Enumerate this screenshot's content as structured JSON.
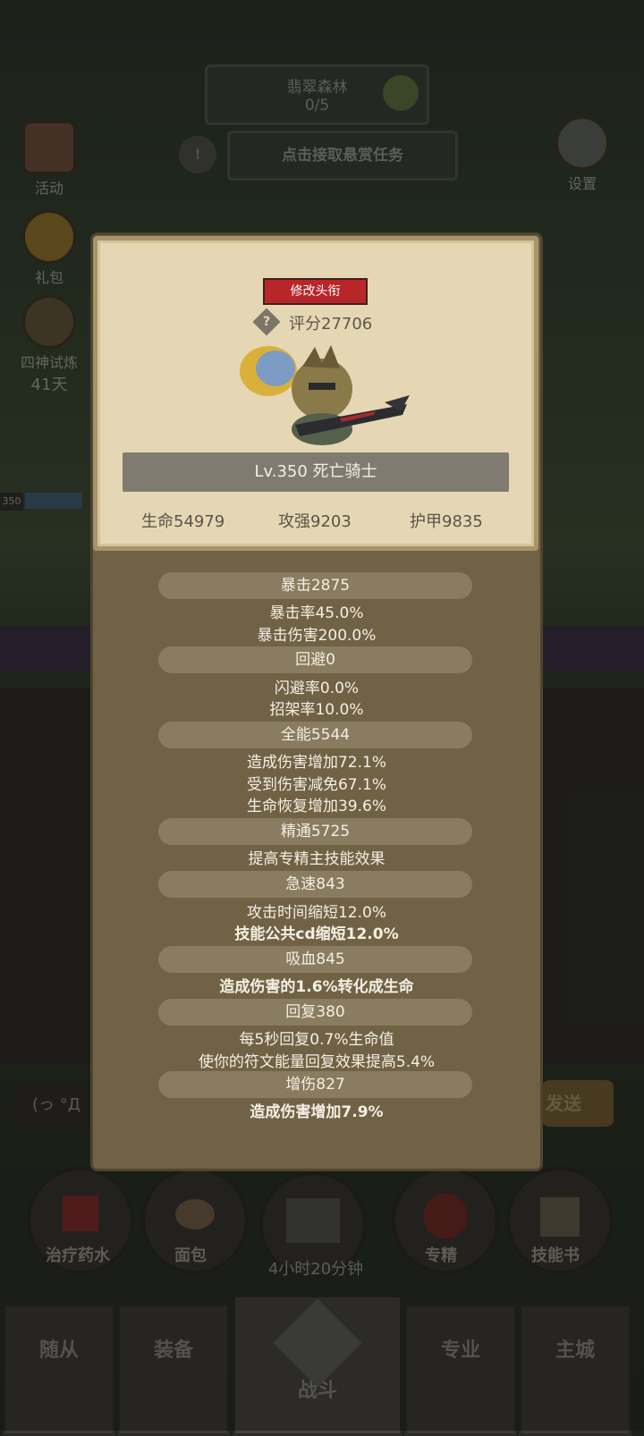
{
  "background": {
    "zone_name": "翡翠森林",
    "zone_progress": "0/5",
    "bounty_prompt": "点击接取悬赏任务",
    "left_menu": [
      {
        "label": "活动",
        "icon": "activity-scroll-icon"
      },
      {
        "label": "礼包",
        "icon": "gift-coin-icon"
      },
      {
        "label": "四神试炼",
        "icon": "trial-helmet-icon",
        "sub": "41天"
      }
    ],
    "settings_label": "设置",
    "player_level_badge": "350",
    "chat_prefix": "(っ °Д",
    "send_label": "发送",
    "quick_items": [
      {
        "label": "治疗药水",
        "icon": "potion-icon"
      },
      {
        "label": "面包",
        "icon": "bread-icon"
      },
      {
        "label": "4小时20分钟",
        "icon": "treasure-chest-icon"
      },
      {
        "label": "专精",
        "icon": "specialization-icon"
      },
      {
        "label": "技能书",
        "icon": "skill-book-icon"
      }
    ],
    "nav_tabs": [
      "随从",
      "装备",
      "战斗",
      "专业",
      "主城"
    ]
  },
  "profile": {
    "title_button": "修改头衔",
    "score": "评分27706",
    "help_icon": "?",
    "name_line": "Lv.350 死亡骑士",
    "core_stats": [
      "生命54979",
      "攻强9203",
      "护甲9835"
    ]
  },
  "stats": [
    {
      "header": "暴击2875",
      "lines": [
        "暴击率45.0%",
        "暴击伤害200.0%"
      ]
    },
    {
      "header": "回避0",
      "lines": [
        "闪避率0.0%",
        "招架率10.0%"
      ]
    },
    {
      "header": "全能5544",
      "lines": [
        "造成伤害增加72.1%",
        "受到伤害减免67.1%",
        "生命恢复增加39.6%"
      ]
    },
    {
      "header": "精通5725",
      "lines": [
        "提高专精主技能效果"
      ]
    },
    {
      "header": "急速843",
      "lines": [
        "攻击时间缩短12.0%",
        "技能公共cd缩短12.0%"
      ]
    },
    {
      "header": "吸血845",
      "lines": [
        "造成伤害的1.6%转化成生命"
      ]
    },
    {
      "header": "回复380",
      "lines": [
        "每5秒回复0.7%生命值",
        "使你的符文能量回复效果提高5.4%"
      ]
    },
    {
      "header": "增伤827",
      "lines": [
        "造成伤害增加7.9%"
      ]
    }
  ],
  "colors": {
    "panel_bg": "#716246",
    "card_bg": "#e6d7b4",
    "title_button": "#b8262a",
    "stat_header": "#8a7c60"
  }
}
